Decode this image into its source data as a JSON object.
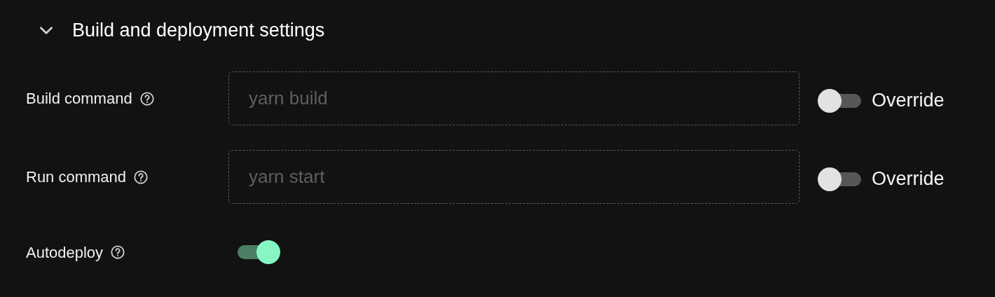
{
  "section": {
    "title": "Build and deployment settings",
    "expanded": true
  },
  "fields": [
    {
      "label": "Build command",
      "placeholder": "yarn build",
      "override": {
        "label": "Override",
        "on": false
      }
    },
    {
      "label": "Run command",
      "placeholder": "yarn start",
      "override": {
        "label": "Override",
        "on": false
      }
    }
  ],
  "autodeploy": {
    "label": "Autodeploy",
    "on": true
  }
}
